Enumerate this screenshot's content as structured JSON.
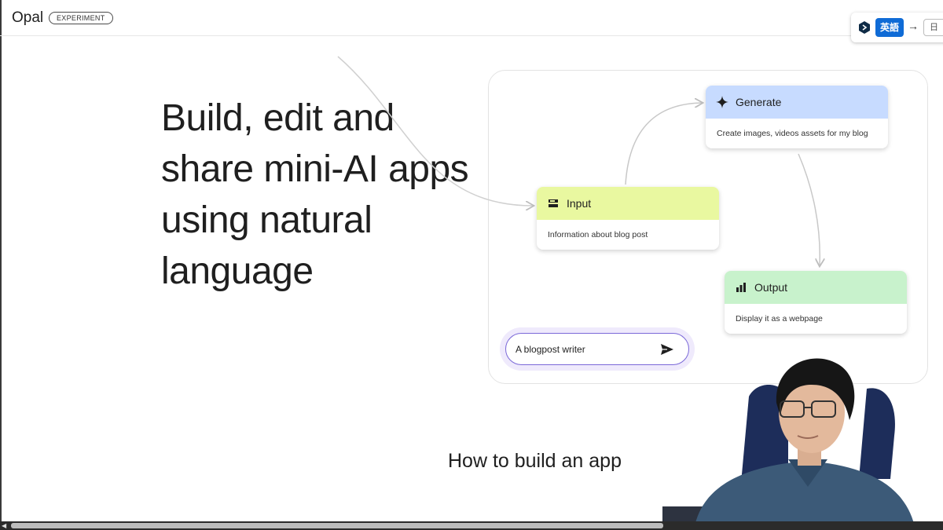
{
  "header": {
    "logo": "Opal",
    "badge": "EXPERIMENT"
  },
  "translator": {
    "source_lang": "英語",
    "target_lang": "日"
  },
  "headline": "Build, edit and share mini-AI apps using natural language",
  "diagram": {
    "nodes": [
      {
        "title": "Generate",
        "description": "Create images, videos assets for my blog",
        "icon": "sparkle-icon",
        "color": "#c7dbff"
      },
      {
        "title": "Input",
        "description": "Information about blog post",
        "icon": "input-icon",
        "color": "#e9f8a0"
      },
      {
        "title": "Output",
        "description": "Display it as a webpage",
        "icon": "chart-icon",
        "color": "#c8f2cc"
      }
    ],
    "prompt": {
      "value": "A blogpost writer",
      "send_icon": "send-icon"
    }
  },
  "caption": "How to build an app",
  "colors": {
    "accent": "#7a68d8",
    "translator_blue": "#0f6bd6"
  }
}
